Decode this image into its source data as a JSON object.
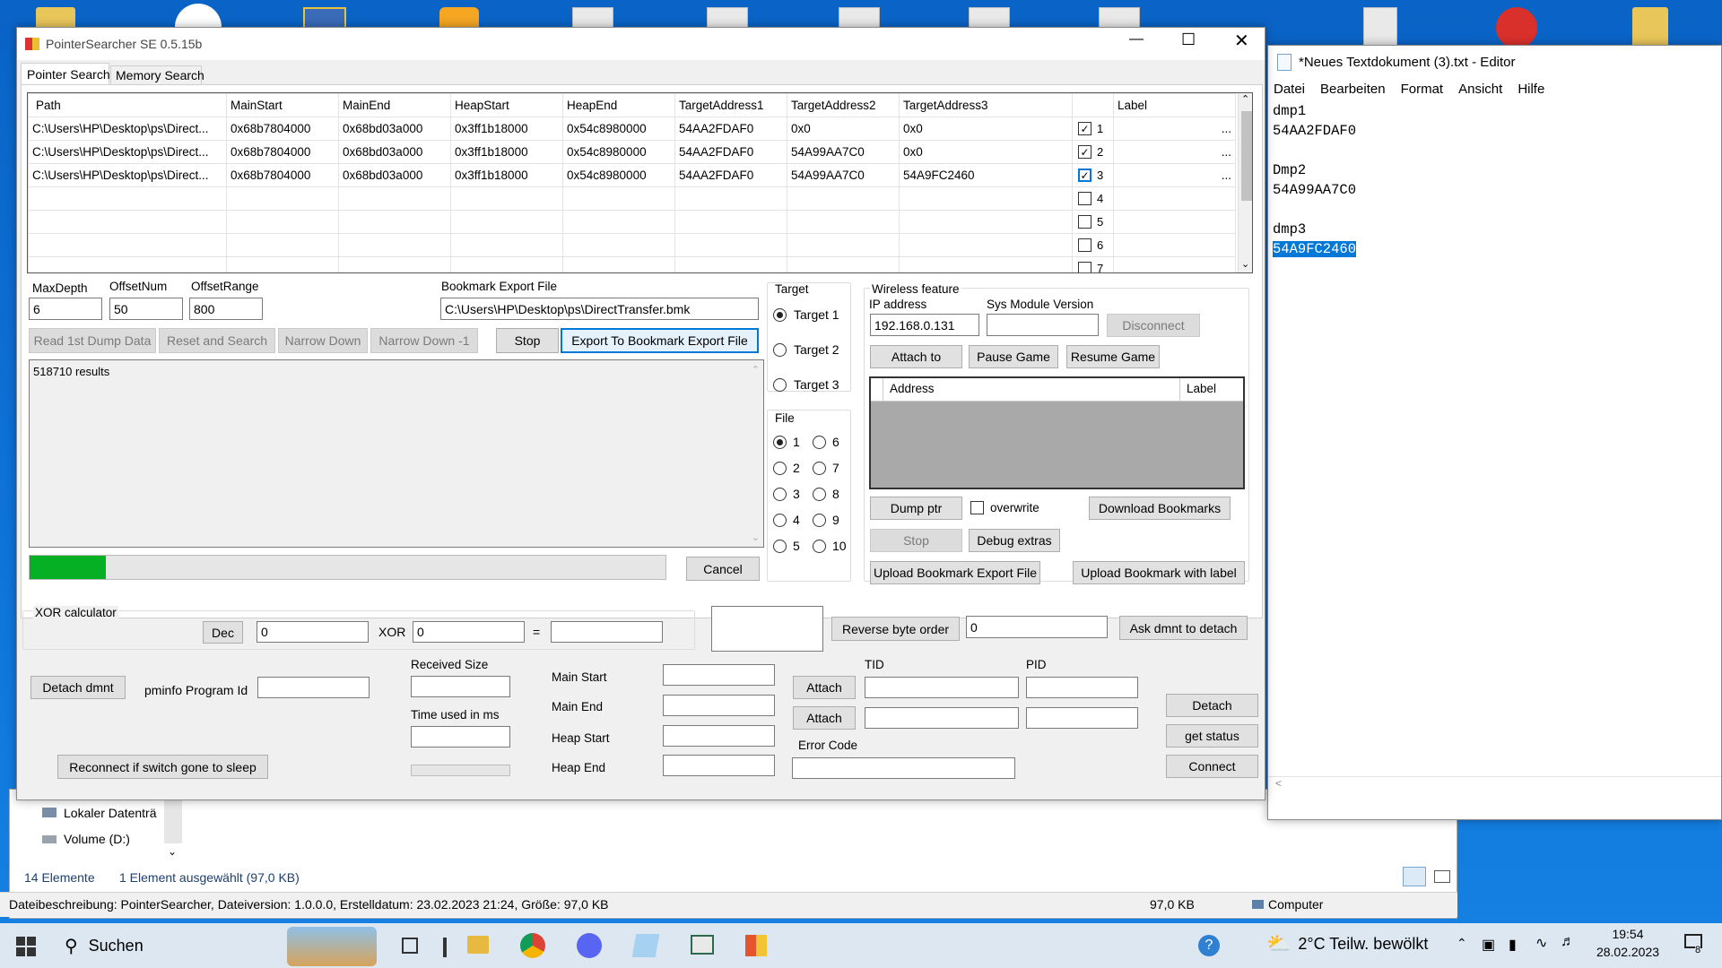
{
  "app": {
    "title": "PointerSearcher SE 0.5.15b",
    "tabs": [
      "Pointer Search",
      "Memory Search"
    ],
    "grid": {
      "columns": [
        "Path",
        "MainStart",
        "MainEnd",
        "HeapStart",
        "HeapEnd",
        "TargetAddress1",
        "TargetAddress2",
        "TargetAddress3",
        "",
        "Label"
      ],
      "rows": [
        {
          "path": "C:\\Users\\HP\\Desktop\\ps\\Direct...",
          "mainstart": "0x68b7804000",
          "mainend": "0x68bd03a000",
          "heapstart": "0x3ff1b18000",
          "heapend": "0x54c8980000",
          "t1": "54AA2FDAF0",
          "t2": "0x0",
          "t3": "0x0",
          "checked": true,
          "num": "1",
          "label": "...",
          "focused": false
        },
        {
          "path": "C:\\Users\\HP\\Desktop\\ps\\Direct...",
          "mainstart": "0x68b7804000",
          "mainend": "0x68bd03a000",
          "heapstart": "0x3ff1b18000",
          "heapend": "0x54c8980000",
          "t1": "54AA2FDAF0",
          "t2": "54A99AA7C0",
          "t3": "0x0",
          "checked": true,
          "num": "2",
          "label": "...",
          "focused": false
        },
        {
          "path": "C:\\Users\\HP\\Desktop\\ps\\Direct...",
          "mainstart": "0x68b7804000",
          "mainend": "0x68bd03a000",
          "heapstart": "0x3ff1b18000",
          "heapend": "0x54c8980000",
          "t1": "54AA2FDAF0",
          "t2": "54A99AA7C0",
          "t3": "54A9FC2460",
          "checked": true,
          "num": "3",
          "label": "...",
          "focused": true
        },
        {
          "path": "",
          "mainstart": "",
          "mainend": "",
          "heapstart": "",
          "heapend": "",
          "t1": "",
          "t2": "",
          "t3": "",
          "checked": false,
          "num": "4",
          "label": "",
          "focused": false
        },
        {
          "path": "",
          "mainstart": "",
          "mainend": "",
          "heapstart": "",
          "heapend": "",
          "t1": "",
          "t2": "",
          "t3": "",
          "checked": false,
          "num": "5",
          "label": "",
          "focused": false
        },
        {
          "path": "",
          "mainstart": "",
          "mainend": "",
          "heapstart": "",
          "heapend": "",
          "t1": "",
          "t2": "",
          "t3": "",
          "checked": false,
          "num": "6",
          "label": "",
          "focused": false
        },
        {
          "path": "",
          "mainstart": "",
          "mainend": "",
          "heapstart": "",
          "heapend": "",
          "t1": "",
          "t2": "",
          "t3": "",
          "checked": false,
          "num": "7",
          "label": "",
          "focused": false
        }
      ]
    },
    "params": {
      "maxdepth_label": "MaxDepth",
      "maxdepth": "6",
      "offsetnum_label": "OffsetNum",
      "offsetnum": "50",
      "offsetrange_label": "OffsetRange",
      "offsetrange": "800",
      "bookmark_label": "Bookmark Export File",
      "bookmark": "C:\\Users\\HP\\Desktop\\ps\\DirectTransfer.bmk"
    },
    "actions": {
      "read": "Read 1st Dump Data",
      "reset": "Reset and Search",
      "narrow": "Narrow Down",
      "narrow1": "Narrow Down -1",
      "stop": "Stop",
      "export": "Export To Bookmark Export File"
    },
    "results": "518710 results",
    "progress": 0.12,
    "cancel": "Cancel",
    "target": {
      "title": "Target",
      "options": [
        "Target 1",
        "Target 2",
        "Target 3"
      ],
      "selected": 0
    },
    "file": {
      "title": "File",
      "options": [
        "1",
        "2",
        "3",
        "4",
        "5",
        "6",
        "7",
        "8",
        "9",
        "10"
      ],
      "selected": 0
    },
    "wireless": {
      "title": "Wireless feature",
      "ip_label": "IP address",
      "ip": "192.168.0.131",
      "sys_label": "Sys Module Version",
      "sys": "",
      "disconnect": "Disconnect",
      "attach": "Attach to",
      "pause": "Pause Game",
      "resume": "Resume Game",
      "list_cols": [
        "Address",
        "Label"
      ],
      "dump": "Dump ptr",
      "overwrite": "overwrite",
      "download": "Download Bookmarks",
      "stop": "Stop",
      "debug": "Debug extras",
      "upload_export": "Upload Bookmark Export File",
      "upload_label": "Upload Bookmark with label"
    },
    "xor": {
      "title": "XOR calculator",
      "dec": "Dec",
      "a": "0",
      "xor": "XOR",
      "b": "0",
      "eq": "=",
      "result": "",
      "reverse": "Reverse byte order",
      "rev_val": "0",
      "ask": "Ask dmnt to detach"
    },
    "bottom": {
      "detach_dmnt": "Detach dmnt",
      "pminfo": "pminfo Program Id",
      "received": "Received Size",
      "time": "Time used in ms",
      "main_start": "Main Start",
      "main_end": "Main End",
      "heap_start": "Heap Start",
      "heap_end": "Heap End",
      "attach": "Attach",
      "tid": "TID",
      "pid": "PID",
      "error": "Error Code",
      "detach": "Detach",
      "status": "get status",
      "connect": "Connect",
      "reconnect": "Reconnect if switch gone to sleep"
    }
  },
  "editor": {
    "title": "*Neues Textdokument (3).txt - Editor",
    "menu": [
      "Datei",
      "Bearbeiten",
      "Format",
      "Ansicht",
      "Hilfe"
    ],
    "lines": [
      "dmp1",
      "54AA2FDAF0",
      "",
      "Dmp2",
      "54A99AA7C0",
      "",
      "dmp3"
    ],
    "selected_line": "54A9FC2460"
  },
  "explorer": {
    "items": [
      "Lokaler Datenträ",
      "Volume (D:)"
    ],
    "count": "14 Elemente",
    "selection": "1 Element ausgewählt (97,0 KB)",
    "desc": "Dateibeschreibung: PointerSearcher, Dateiversion: 1.0.0.0, Erstelldatum: 23.02.2023 21:24, Größe: 97,0 KB",
    "size": "97,0 KB",
    "location": "Computer"
  },
  "taskbar": {
    "search": "Suchen",
    "weather": "2°C  Teilw. bewölkt",
    "time": "19:54",
    "date": "28.02.2023",
    "notif": "8",
    "icons": [
      "widgets-icon",
      "task-view-icon",
      "file-explorer-icon",
      "chrome-icon",
      "discord-icon",
      "notepad-icon",
      "terminal-icon",
      "office-icon"
    ]
  },
  "colors": {
    "accent": "#0078d7",
    "progress": "#06b025",
    "selection": "#0078d7"
  }
}
